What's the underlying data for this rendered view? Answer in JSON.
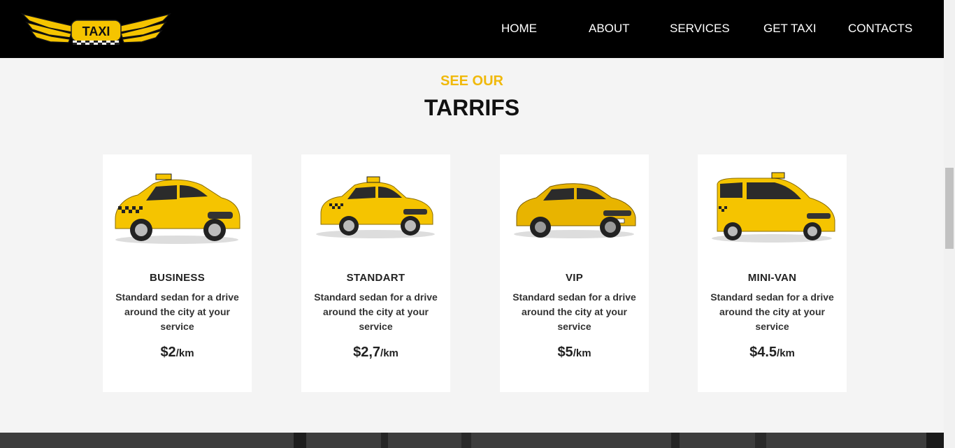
{
  "brand": {
    "logo_text": "TAXI"
  },
  "nav": {
    "items": [
      {
        "label": "HOME"
      },
      {
        "label": "ABOUT"
      },
      {
        "label": "SERVICES"
      },
      {
        "label": "GET TAXI"
      },
      {
        "label": "CONTACTS"
      }
    ]
  },
  "section": {
    "eyebrow": "SEE OUR",
    "title": "TARRIFS"
  },
  "tariffs": [
    {
      "name": "BUSINESS",
      "description": "Standard sedan for a drive around the city at your service",
      "price": "$2",
      "unit": "/km",
      "icon": "taxi-hatchback-icon"
    },
    {
      "name": "STANDART",
      "description": "Standard sedan for a drive around the city at your service",
      "price": "$2,7",
      "unit": "/km",
      "icon": "taxi-sedan-icon"
    },
    {
      "name": "VIP",
      "description": "Standard sedan for a drive around the city at your service",
      "price": "$5",
      "unit": "/km",
      "icon": "suv-icon"
    },
    {
      "name": "MINI-VAN",
      "description": "Standard sedan for a drive around the city at your service",
      "price": "$4.5",
      "unit": "/km",
      "icon": "minivan-icon"
    }
  ],
  "colors": {
    "accent": "#f0b90b",
    "nav_bg": "#000000",
    "page_bg": "#f4f4f4",
    "card_bg": "#ffffff"
  }
}
